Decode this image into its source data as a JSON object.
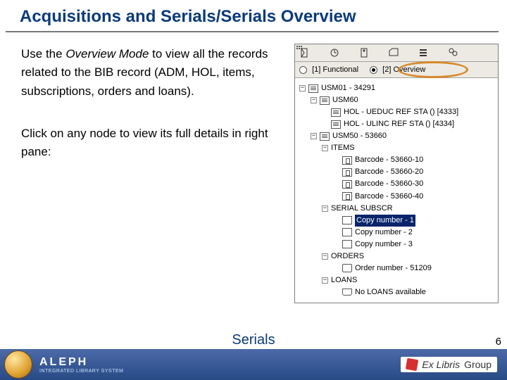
{
  "title": "Acquisitions and Serials/Serials Overview",
  "para1_a": "Use the ",
  "para1_em": "Overview Mode",
  "para1_b": " to view all the records related to the BIB record (ADM, HOL, items, subscriptions, orders and loans).",
  "para2": "Click on any node to view its full details in right pane:",
  "tabs": {
    "functional": "[1] Functional",
    "overview": "[2] Overview"
  },
  "tree": {
    "n0": "USM01 - 34291",
    "n1": "USM60",
    "n2": "HOL - UEDUC REF STA () [4333]",
    "n3": "HOL - ULINC REF STA () [4334]",
    "n4": "USM50 - 53660",
    "n5": "ITEMS",
    "n6": "Barcode - 53660-10",
    "n7": "Barcode - 53660-20",
    "n8": "Barcode - 53660-30",
    "n9": "Barcode - 53660-40",
    "n10": "SERIAL SUBSCR",
    "n11": "Copy number - 1",
    "n12": "Copy number - 2",
    "n13": "Copy number - 3",
    "n14": "ORDERS",
    "n15": "Order number - 51209",
    "n16": "LOANS",
    "n17": "No LOANS available"
  },
  "footer": {
    "brand": "ALEPH",
    "brand_sub": "INTEGRATED LIBRARY SYSTEM",
    "center": "Serials",
    "exl1": "Ex Libris",
    "exl2": "Group"
  },
  "page_number": "6"
}
